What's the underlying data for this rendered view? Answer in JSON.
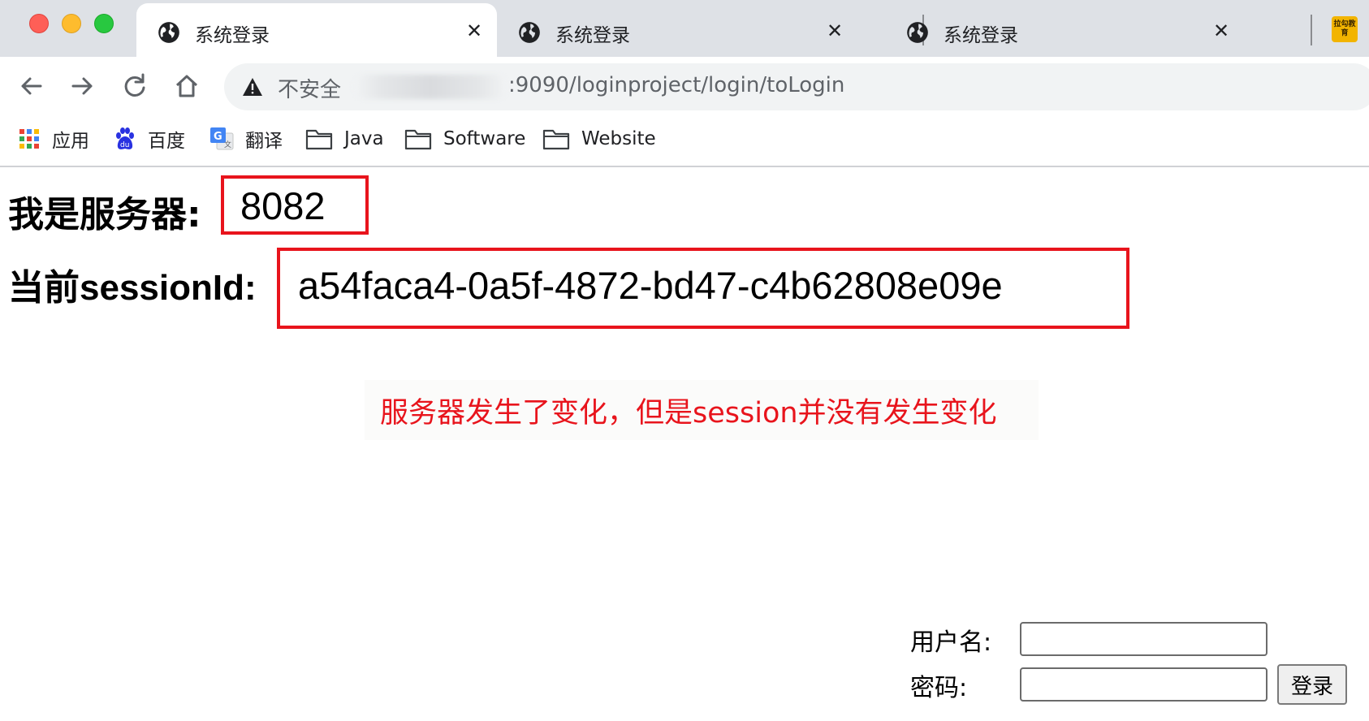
{
  "browser": {
    "tabs": [
      {
        "title": "系统登录",
        "close": "✕"
      },
      {
        "title": "系统登录",
        "close": "✕"
      },
      {
        "title": "系统登录",
        "close": "✕"
      }
    ],
    "extension_label": "拉勾教育",
    "omnibox": {
      "security": "不安全",
      "url_visible": ":9090/loginproject/login/toLogin"
    },
    "bookmarks": [
      {
        "label": "应用",
        "icon": "apps-grid-icon"
      },
      {
        "label": "百度",
        "icon": "baidu-paw-icon"
      },
      {
        "label": "翻译",
        "icon": "google-translate-icon"
      },
      {
        "label": "Java",
        "icon": "folder-icon"
      },
      {
        "label": "Software",
        "icon": "folder-icon"
      },
      {
        "label": "Website",
        "icon": "folder-icon"
      }
    ]
  },
  "page": {
    "server_label": "我是服务器:",
    "server_value": "8082",
    "session_label": "当前sessionId:",
    "session_value": "a54faca4-0a5f-4872-bd47-c4b62808e09e",
    "note": "服务器发生了变化，但是session并没有发生变化",
    "login": {
      "username_label": "用户名:",
      "username_value": "",
      "password_label": "密码:",
      "password_value": "",
      "submit_label": "登录"
    }
  },
  "colors": {
    "highlight_red": "#e8141c",
    "tabstrip_bg": "#dee1e6",
    "omnibox_bg": "#f1f3f4"
  }
}
